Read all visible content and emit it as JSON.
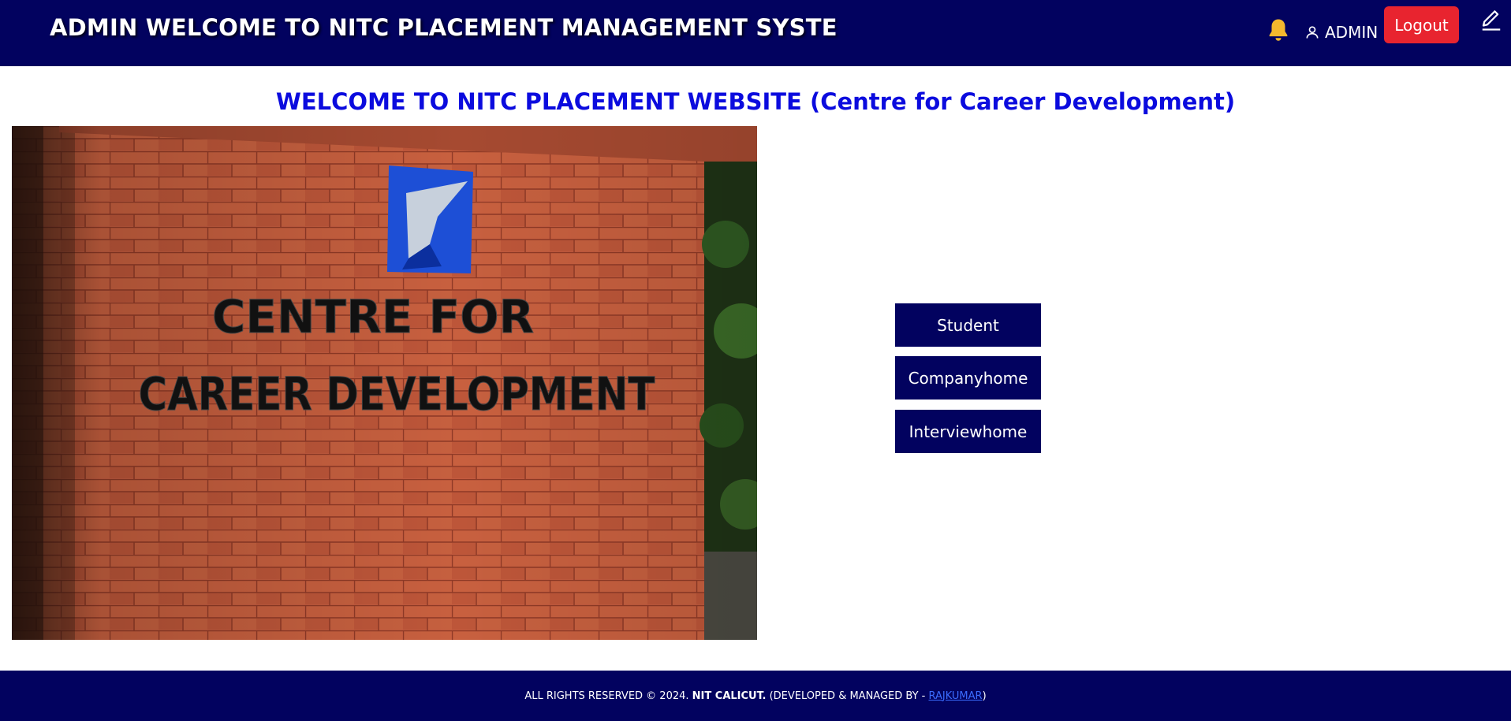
{
  "header": {
    "title": "ADMIN WELCOME TO NITC PLACEMENT MANAGEMENT SYSTE",
    "icons": {
      "notifications": "bell-icon",
      "user": "user-icon",
      "edit": "pencil-icon"
    },
    "user_label": "ADMIN",
    "logout_label": "Logout"
  },
  "main": {
    "heading": "WELCOME TO NITC PLACEMENT WEBSITE (Centre for Career Development)",
    "hero_image": {
      "sign_line1": "CENTRE FOR",
      "sign_line2": "CAREER DEVELOPMENT"
    },
    "buttons": [
      {
        "label": "Student"
      },
      {
        "label": "Companyhome"
      },
      {
        "label": "Interviewhome"
      }
    ]
  },
  "footer": {
    "rights": "ALL RIGHTS RESERVED © 2024.",
    "org": "NIT CALICUT.",
    "managed_prefix": "(DEVELOPED & MANAGED BY -",
    "developer": "RAJKUMAR",
    "managed_suffix": ")"
  },
  "colors": {
    "navbar": "#02025f",
    "logout": "#e8242f",
    "heading": "#0b0bde",
    "bell": "#f5b82e",
    "footer_link": "#3b6cff"
  }
}
